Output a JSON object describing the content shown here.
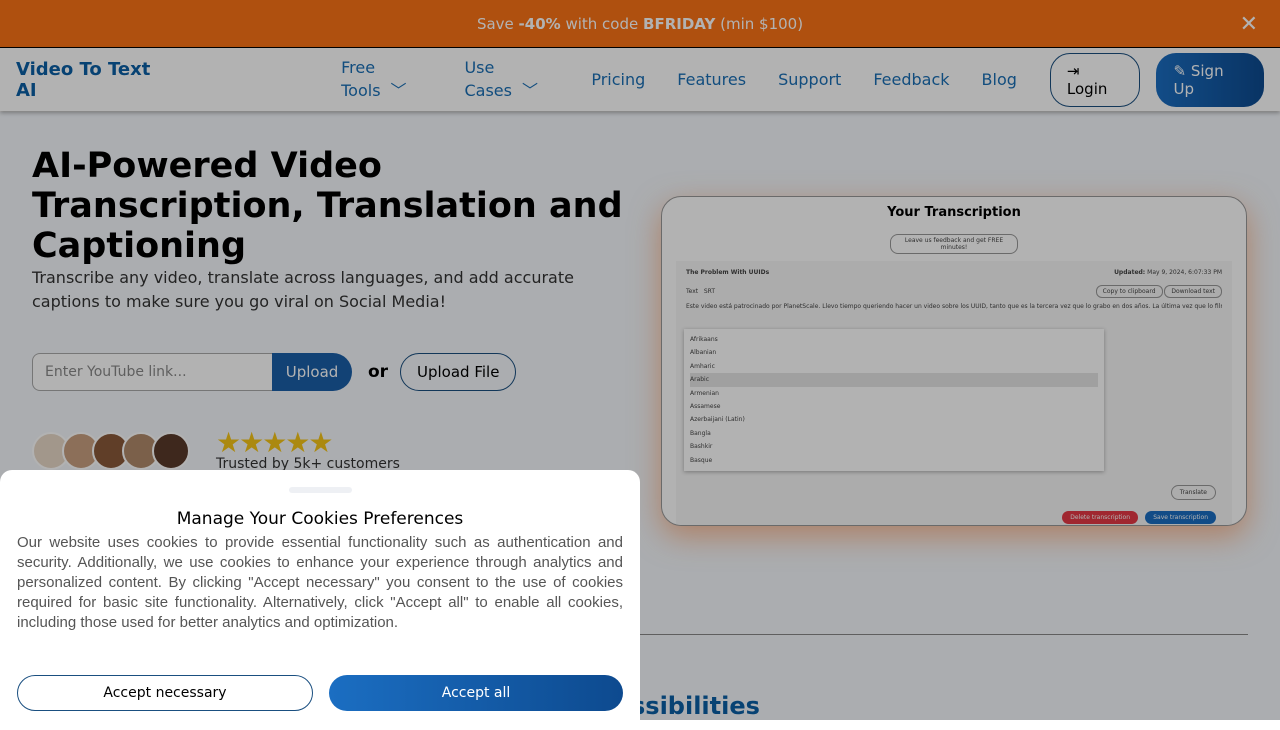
{
  "banner": {
    "pre": "Save ",
    "discount": "-40%",
    "mid": " with code ",
    "code": "BFRIDAY",
    "post": " (min $100)"
  },
  "nav": {
    "logo": "Video To Text AI",
    "links": [
      "Free Tools",
      "Use Cases",
      "Pricing",
      "Features",
      "Support",
      "Feedback",
      "Blog"
    ],
    "login": "Login",
    "signup": "Sign Up"
  },
  "hero": {
    "title": "AI-Powered Video Transcription, Translation and Captioning",
    "subtitle": "Transcribe any video, translate across languages, and add accurate captions to make sure you go viral on Social Media!",
    "input_placeholder": "Enter YouTube link...",
    "upload": "Upload",
    "or": "or",
    "upload_file": "Upload File",
    "stars": "★★★★★",
    "trusted": "Trusted by 5k+ customers"
  },
  "preview": {
    "title": "Your Transcription",
    "feedback": "Leave us feedback and get FREE minutes!",
    "video_title": "The Problem With UUIDs",
    "updated_label": "Updated:",
    "updated": "May 9, 2024, 6:07:33 PM",
    "tabs": [
      "Text",
      "SRT"
    ],
    "copy": "Copy to clipboard",
    "download": "Download text",
    "text": "Este video está patrocinado por PlanetScale. Llevo tiempo queriendo hacer un video sobre los UUID, tanto que es la tercera vez que lo grabo en dos años. La última vez que lo filmé fue en el...",
    "languages": [
      "Afrikaans",
      "Albanian",
      "Amharic",
      "Arabic",
      "Armenian",
      "Assamese",
      "Azerbaijani (Latin)",
      "Bangla",
      "Bashkir",
      "Basque"
    ],
    "translate": "Translate",
    "delete": "Delete transcription",
    "save": "Save transcription"
  },
  "section": {
    "heading": "ss Possibilities"
  },
  "cookies": {
    "title": "Manage Your Cookies Preferences",
    "body": "Our website uses cookies to provide essential functionality such as authentication and security. Additionally, we use cookies to enhance your experience through analytics and personalized content. By clicking \"Accept necessary\" you consent to the use of cookies required for basic site functionality. Alternatively, click \"Accept all\" to enable all cookies, including those used for better analytics and optimization.",
    "accept_necessary": "Accept necessary",
    "accept_all": "Accept all"
  }
}
